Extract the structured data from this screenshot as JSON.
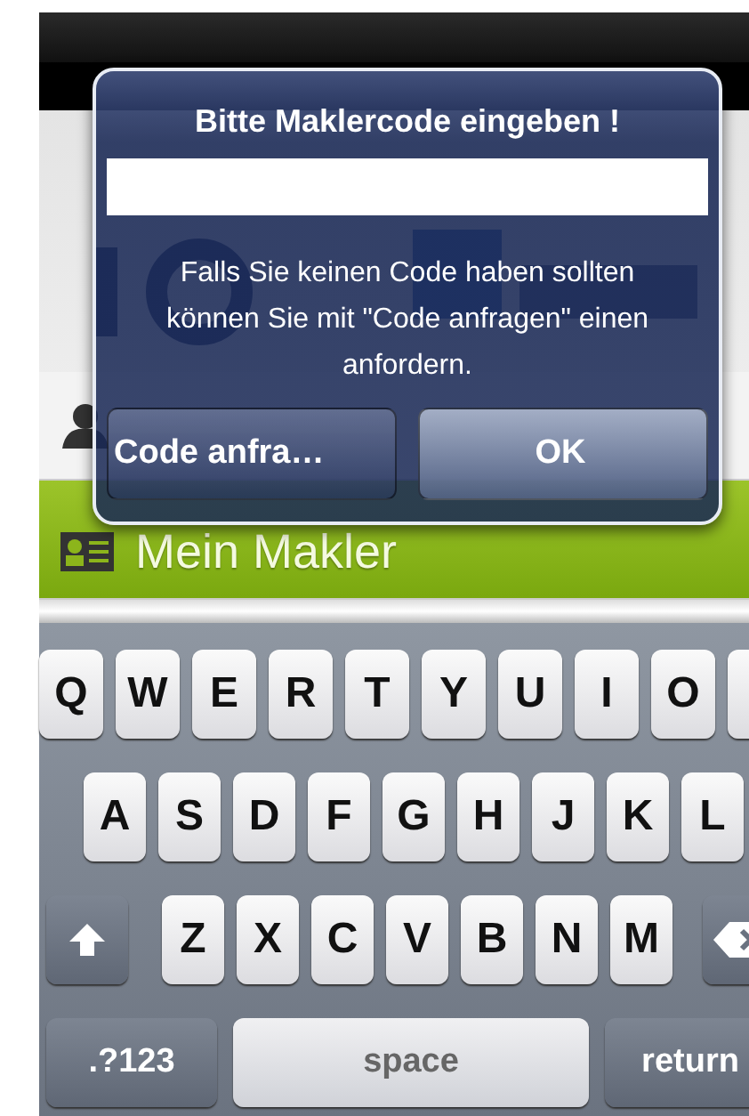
{
  "menu_items": [
    {
      "selected": false
    },
    {
      "label": "Mein Makler",
      "selected": true
    }
  ],
  "alert": {
    "title": "Bitte Maklercode eingeben !",
    "message": "Falls Sie keinen Code haben sollten können Sie mit \"Code anfragen\" einen anfordern.",
    "buttons": [
      {
        "label": "Code anfra…",
        "kind": "cancel"
      },
      {
        "label": "OK",
        "kind": "default"
      }
    ]
  },
  "keyboard": {
    "rows": [
      {
        "keys": [
          {
            "kind": "letter",
            "label": "Q"
          },
          {
            "kind": "letter",
            "label": "W"
          },
          {
            "kind": "letter",
            "label": "E"
          },
          {
            "kind": "letter",
            "label": "R"
          },
          {
            "kind": "letter",
            "label": "T"
          },
          {
            "kind": "letter",
            "label": "Y"
          },
          {
            "kind": "letter",
            "label": "U"
          },
          {
            "kind": "letter",
            "label": "I"
          },
          {
            "kind": "letter",
            "label": "O"
          },
          {
            "kind": "letter"
          }
        ]
      },
      {
        "keys": [
          {
            "kind": "letter",
            "label": "A"
          },
          {
            "kind": "letter",
            "label": "S"
          },
          {
            "kind": "letter",
            "label": "D"
          },
          {
            "kind": "letter",
            "label": "F"
          },
          {
            "kind": "letter",
            "label": "G"
          },
          {
            "kind": "letter",
            "label": "H"
          },
          {
            "kind": "letter",
            "label": "J"
          },
          {
            "kind": "letter",
            "label": "K"
          },
          {
            "kind": "letter",
            "label": "L"
          }
        ]
      },
      {
        "keys": [
          {
            "kind": "shift"
          },
          {
            "kind": "letter",
            "label": "Z"
          },
          {
            "kind": "letter",
            "label": "X"
          },
          {
            "kind": "letter",
            "label": "C"
          },
          {
            "kind": "letter",
            "label": "V"
          },
          {
            "kind": "letter",
            "label": "B"
          },
          {
            "kind": "letter",
            "label": "N"
          },
          {
            "kind": "letter",
            "label": "M"
          },
          {
            "kind": "backspace"
          }
        ]
      },
      {
        "keys": [
          {
            "kind": "mode",
            "label": ".?123"
          },
          {
            "kind": "space",
            "label": "space"
          },
          {
            "kind": "return",
            "label": "return"
          }
        ]
      }
    ]
  }
}
